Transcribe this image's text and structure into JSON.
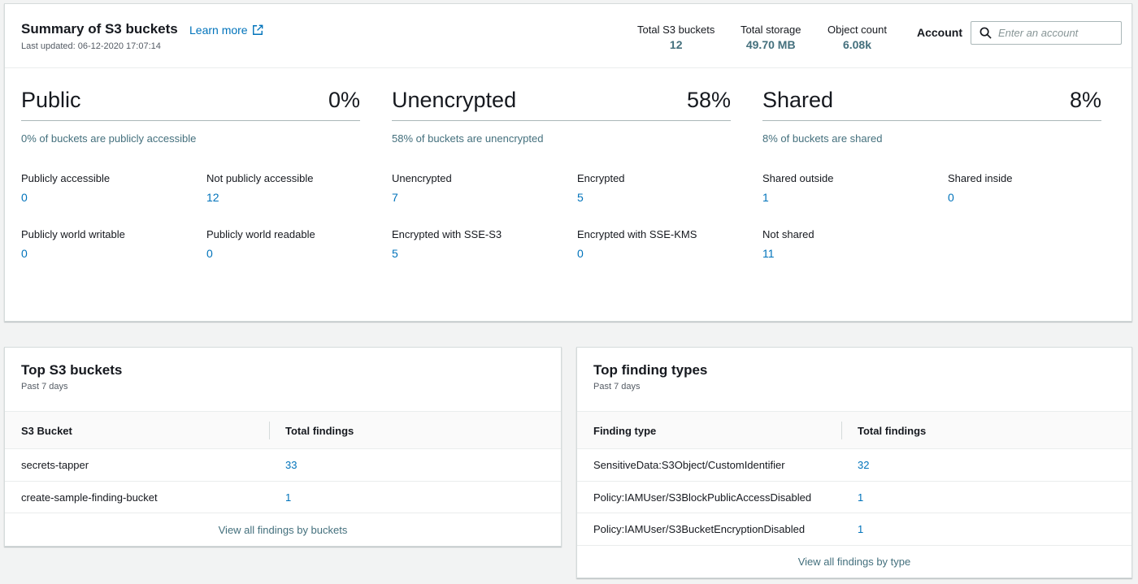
{
  "summary": {
    "title": "Summary of S3 buckets",
    "learn_more": "Learn more",
    "last_updated": "Last updated: 06-12-2020 17:07:14",
    "stats": [
      {
        "label": "Total S3 buckets",
        "value": "12"
      },
      {
        "label": "Total storage",
        "value": "49.70 MB"
      },
      {
        "label": "Object count",
        "value": "6.08k"
      }
    ],
    "account_label": "Account",
    "account_placeholder": "Enter an account",
    "columns": [
      {
        "name": "Public",
        "percent": "0%",
        "description": "0% of buckets are publicly accessible",
        "metrics": [
          {
            "label": "Publicly accessible",
            "value": "0"
          },
          {
            "label": "Not publicly accessible",
            "value": "12"
          },
          {
            "label": "Publicly world writable",
            "value": "0"
          },
          {
            "label": "Publicly world readable",
            "value": "0"
          }
        ]
      },
      {
        "name": "Unencrypted",
        "percent": "58%",
        "description": "58% of buckets are unencrypted",
        "metrics": [
          {
            "label": "Unencrypted",
            "value": "7"
          },
          {
            "label": "Encrypted",
            "value": "5"
          },
          {
            "label": "Encrypted with SSE-S3",
            "value": "5"
          },
          {
            "label": "Encrypted with SSE-KMS",
            "value": "0"
          }
        ]
      },
      {
        "name": "Shared",
        "percent": "8%",
        "description": "8% of buckets are shared",
        "metrics": [
          {
            "label": "Shared outside",
            "value": "1"
          },
          {
            "label": "Shared inside",
            "value": "0"
          },
          {
            "label": "Not shared",
            "value": "11"
          }
        ]
      }
    ]
  },
  "top_buckets": {
    "title": "Top S3 buckets",
    "subtitle": "Past 7 days",
    "headers": [
      "S3 Bucket",
      "Total findings"
    ],
    "rows": [
      {
        "name": "secrets-tapper",
        "count": "33"
      },
      {
        "name": "create-sample-finding-bucket",
        "count": "1"
      }
    ],
    "view_all": "View all findings by buckets"
  },
  "top_findings": {
    "title": "Top finding types",
    "subtitle": "Past 7 days",
    "headers": [
      "Finding type",
      "Total findings"
    ],
    "rows": [
      {
        "name": "SensitiveData:S3Object/CustomIdentifier",
        "count": "32"
      },
      {
        "name": "Policy:IAMUser/S3BlockPublicAccessDisabled",
        "count": "1"
      },
      {
        "name": "Policy:IAMUser/S3BucketEncryptionDisabled",
        "count": "1"
      }
    ],
    "view_all": "View all findings by type"
  },
  "colors": {
    "link": "#0073bb",
    "stat_value": "#44707d",
    "background": "#f2f3f3"
  },
  "icons": {
    "learn_more": "external-link-icon",
    "account_search": "search-icon"
  }
}
